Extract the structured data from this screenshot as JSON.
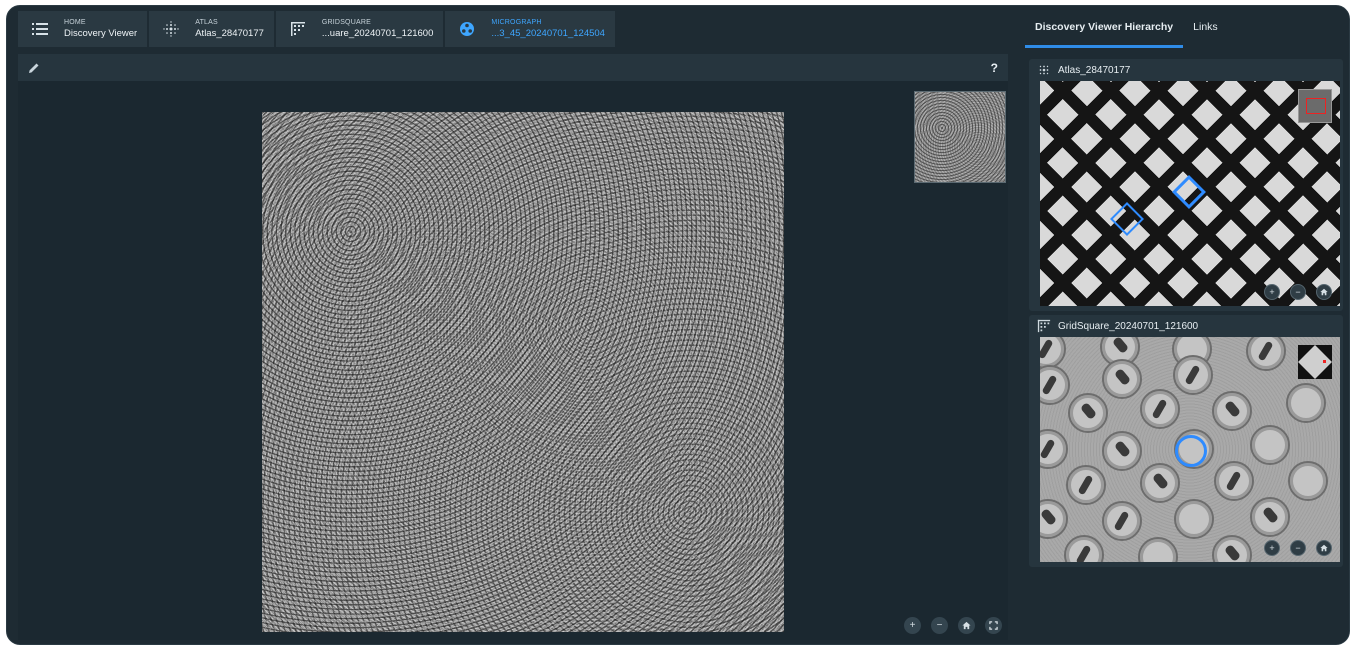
{
  "breadcrumbs": [
    {
      "label": "HOME",
      "value": "Discovery Viewer",
      "icon": "list-icon",
      "active": false
    },
    {
      "label": "ATLAS",
      "value": "Atlas_28470177",
      "icon": "atlas-grid-icon",
      "active": false
    },
    {
      "label": "GRIDSQUARE",
      "value": "...uare_20240701_121600",
      "icon": "gridsquare-icon",
      "active": false
    },
    {
      "label": "MICROGRAPH",
      "value": "...3_45_20240701_124504",
      "icon": "micrograph-icon",
      "active": true
    }
  ],
  "viewer": {
    "help_label": "?",
    "zoom_controls": [
      "+",
      "−",
      "home",
      "fullscreen"
    ]
  },
  "right_panel": {
    "tabs": [
      "Discovery Viewer Hierarchy",
      "Links"
    ],
    "selected_tab": "Discovery Viewer Hierarchy",
    "cards": [
      {
        "title": "Atlas_28470177",
        "icon": "atlas-grid-icon"
      },
      {
        "title": "GridSquare_20240701_121600",
        "icon": "gridsquare-icon"
      }
    ]
  },
  "colors": {
    "accent": "#3ea6ff",
    "selection": "#2e8bff",
    "background": "#1e2b33"
  }
}
